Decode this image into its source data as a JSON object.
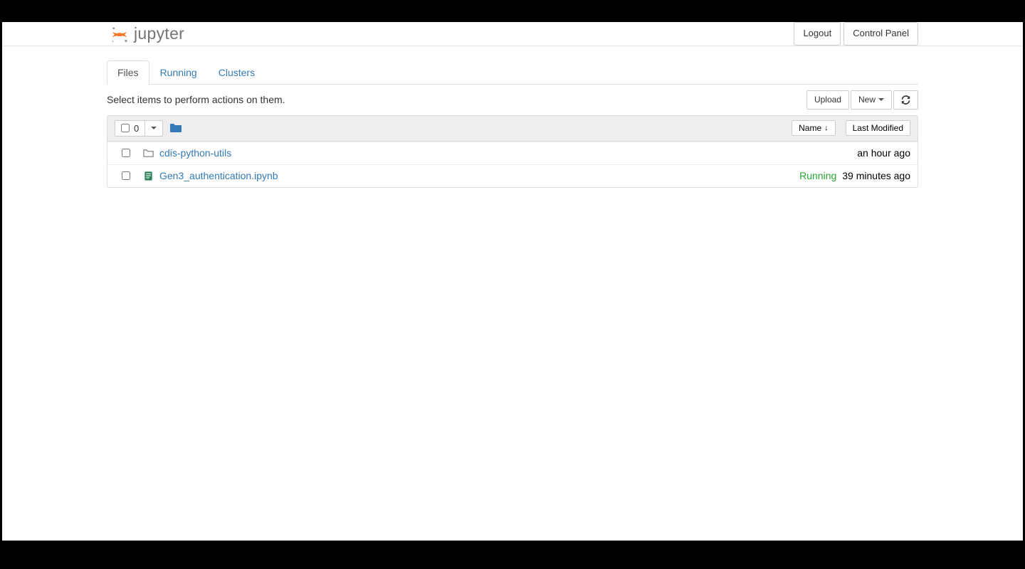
{
  "header": {
    "brand": "jupyter",
    "logout": "Logout",
    "control_panel": "Control Panel"
  },
  "tabs": {
    "files": "Files",
    "running": "Running",
    "clusters": "Clusters",
    "active": "files"
  },
  "actions": {
    "instructions": "Select items to perform actions on them.",
    "upload": "Upload",
    "new_label": "New"
  },
  "list_header": {
    "selected_count": "0",
    "sort_name": "Name",
    "sort_modified": "Last Modified"
  },
  "rows": [
    {
      "type": "folder",
      "name": "cdis-python-utils",
      "status": "",
      "modified": "an hour ago"
    },
    {
      "type": "notebook",
      "name": "Gen3_authentication.ipynb",
      "status": "Running",
      "modified": "39 minutes ago"
    }
  ],
  "colors": {
    "link": "#337ab7",
    "running": "#26a531",
    "nb_icon": "#2e8458",
    "folder_icon": "#888"
  }
}
